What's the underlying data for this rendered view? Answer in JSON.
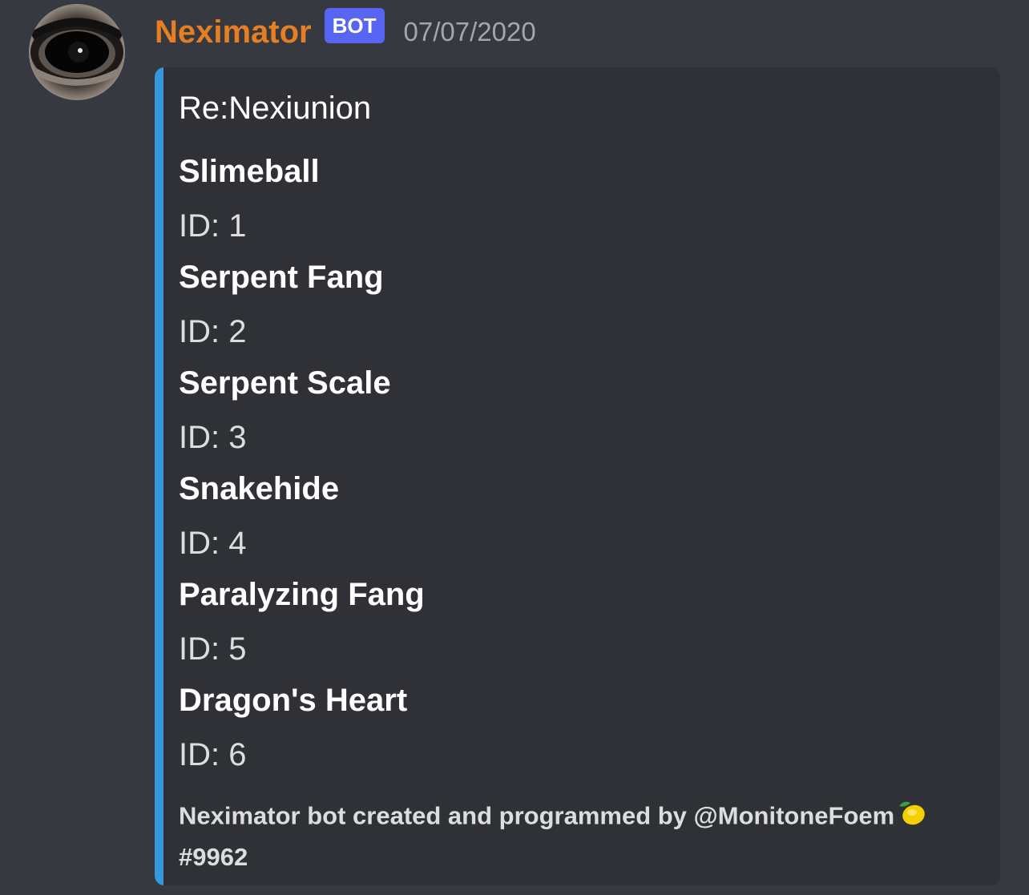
{
  "message": {
    "author": "Neximator",
    "bot_tag": "BOT",
    "timestamp": "07/07/2020"
  },
  "embed": {
    "accent_color": "#3498db",
    "title": "Re:Nexiunion",
    "fields": [
      {
        "name": "Slimeball",
        "value": "ID: 1"
      },
      {
        "name": "Serpent Fang",
        "value": "ID: 2"
      },
      {
        "name": "Serpent Scale",
        "value": "ID: 3"
      },
      {
        "name": "Snakehide",
        "value": "ID: 4"
      },
      {
        "name": "Paralyzing Fang",
        "value": "ID: 5"
      },
      {
        "name": "Dragon's Heart",
        "value": "ID: 6"
      }
    ],
    "footer_text": "Neximator bot created and programmed by @MonitoneFoem",
    "footer_emoji": "lemon-emoji",
    "footer_tag": "#9962"
  },
  "colors": {
    "background": "#36393f",
    "embed_background": "#2f3136",
    "username": "#e67e22",
    "bot_tag": "#5865f2"
  }
}
